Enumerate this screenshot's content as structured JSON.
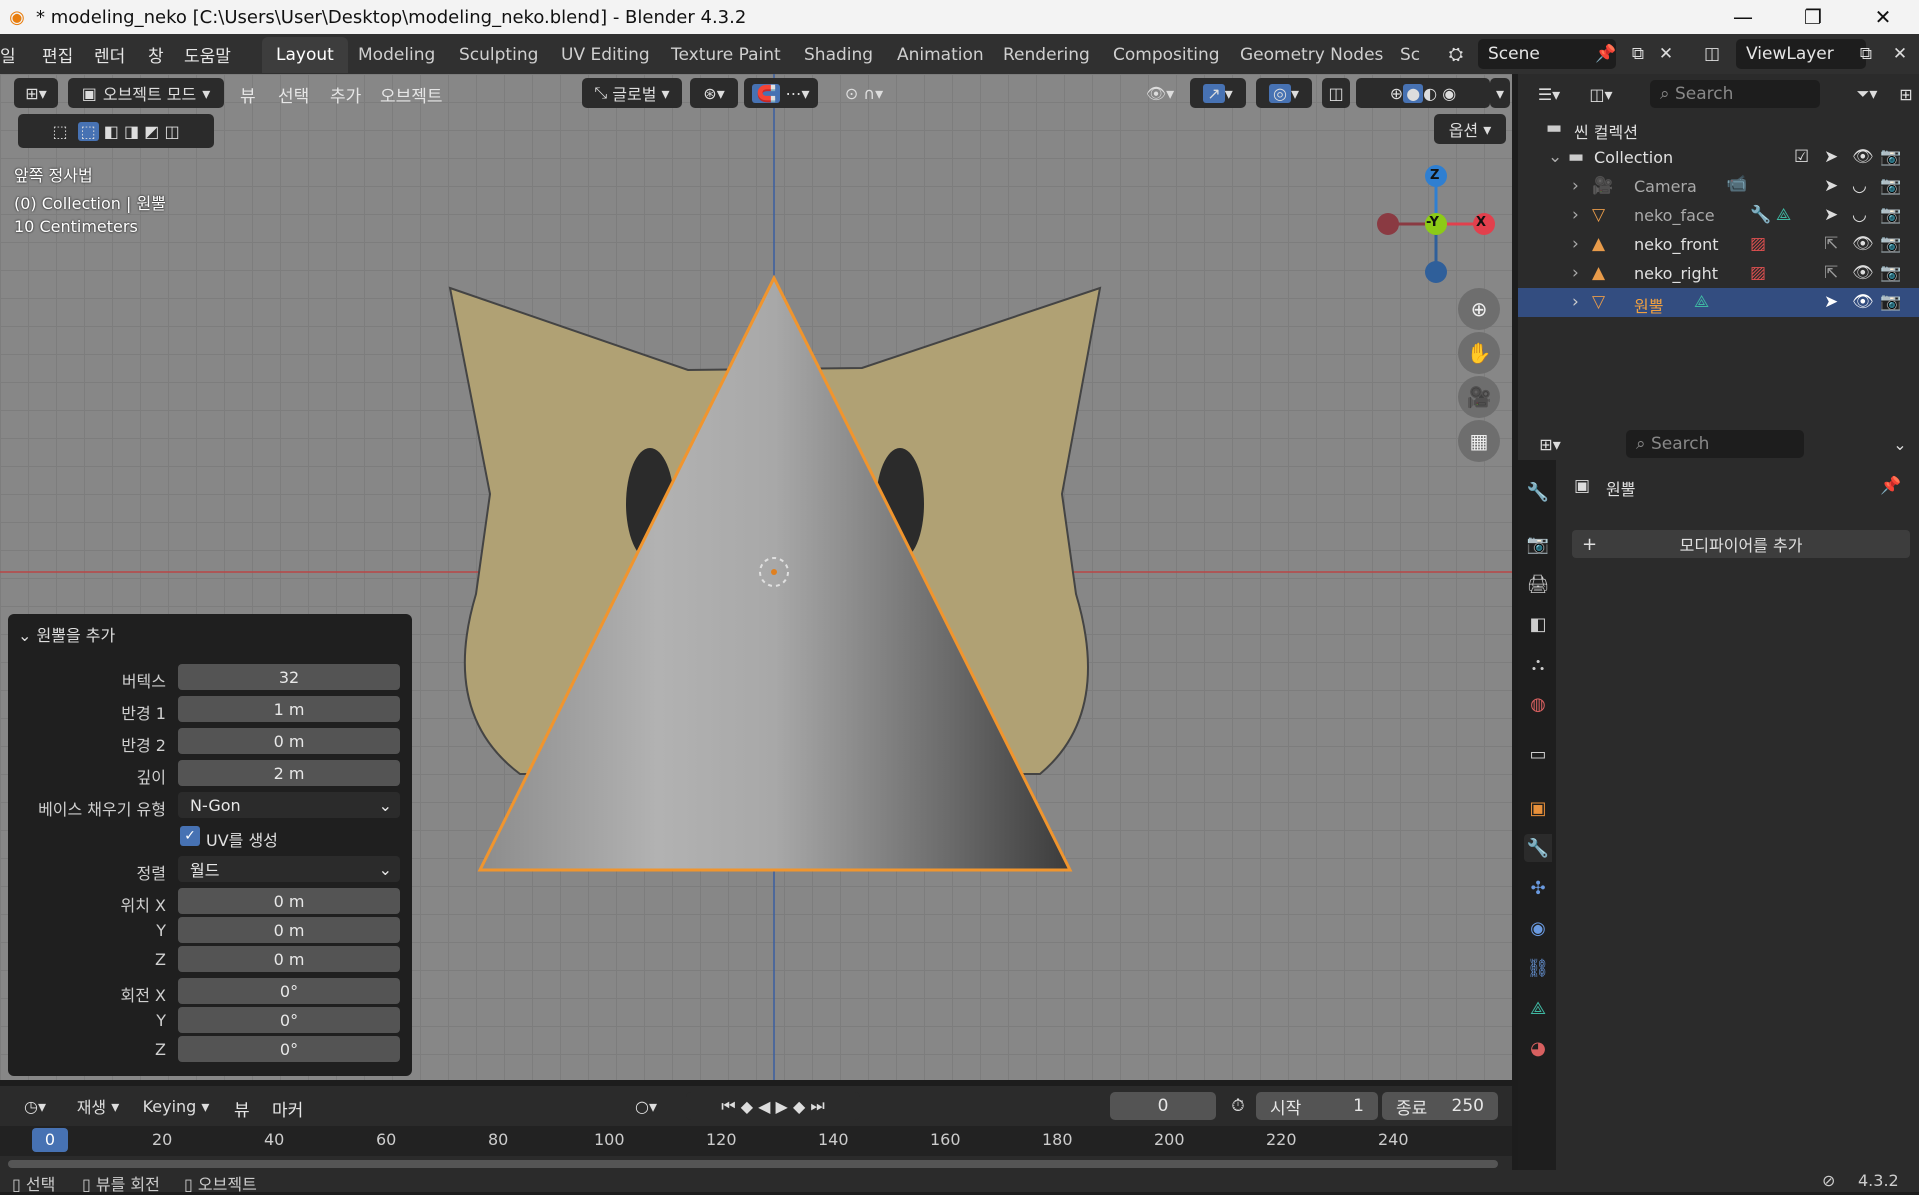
{
  "window": {
    "title": "* modeling_neko [C:\\Users\\User\\Desktop\\modeling_neko.blend] - Blender 4.3.2"
  },
  "menus": [
    "일",
    "편집",
    "렌더",
    "창",
    "도움말"
  ],
  "workspaces": [
    "Layout",
    "Modeling",
    "Sculpting",
    "UV Editing",
    "Texture Paint",
    "Shading",
    "Animation",
    "Rendering",
    "Compositing",
    "Geometry Nodes",
    "Sc"
  ],
  "scene": {
    "name": "Scene",
    "view_layer": "ViewLayer"
  },
  "viewport_header": {
    "mode": "오브젝트 모드",
    "menus": [
      "뷰",
      "선택",
      "추가",
      "오브젝트"
    ],
    "transform": "글로벌",
    "options": "옵션"
  },
  "viewport_info": {
    "view": "앞쪽 정사법",
    "context": "(0) Collection | 원뿔",
    "scale": "10 Centimeters"
  },
  "gizmo": {
    "z": "Z",
    "y": "-Y",
    "x": "X",
    "colors": {
      "x": "#e2404d",
      "y": "#8ccb17",
      "z": "#2f7fd1"
    }
  },
  "operator_panel": {
    "title": "원뿔을 추가",
    "vertices_label": "버텍스",
    "vertices": "32",
    "radius1_label": "반경 1",
    "radius1": "1 m",
    "radius2_label": "반경 2",
    "radius2": "0 m",
    "depth_label": "깊이",
    "depth": "2 m",
    "base_fill_label": "베이스 채우기 유형",
    "base_fill": "N-Gon",
    "uv_label": "UV를 생성",
    "uv_checked": true,
    "align_label": "정렬",
    "align": "월드",
    "loc_x_label": "위치 X",
    "loc_y_label": "Y",
    "loc_z_label": "Z",
    "loc_x": "0 m",
    "loc_y": "0 m",
    "loc_z": "0 m",
    "rot_x_label": "회전 X",
    "rot_y_label": "Y",
    "rot_z_label": "Z",
    "rot_x": "0°",
    "rot_y": "0°",
    "rot_z": "0°"
  },
  "timeline": {
    "menus": [
      "재생",
      "Keying",
      "뷰",
      "마커"
    ],
    "current_frame": "0",
    "start_label": "시작",
    "start": "1",
    "end_label": "종료",
    "end": "250",
    "ticks": [
      "0",
      "20",
      "40",
      "60",
      "80",
      "100",
      "120",
      "140",
      "160",
      "180",
      "200",
      "220",
      "240"
    ]
  },
  "status": {
    "select": "선택",
    "rotate_view": "뷰를 회전",
    "object": "오브젝트",
    "version": "4.3.2"
  },
  "outliner": {
    "search_placeholder": "Search",
    "scene_collection": "씬 컬렉션",
    "collection": "Collection",
    "items": [
      {
        "name": "Camera"
      },
      {
        "name": "neko_face"
      },
      {
        "name": "neko_front"
      },
      {
        "name": "neko_right"
      },
      {
        "name": "원뿔"
      }
    ]
  },
  "properties": {
    "search_placeholder": "Search",
    "object_name": "원뿔",
    "add_modifier": "모디파이어를 추가"
  }
}
